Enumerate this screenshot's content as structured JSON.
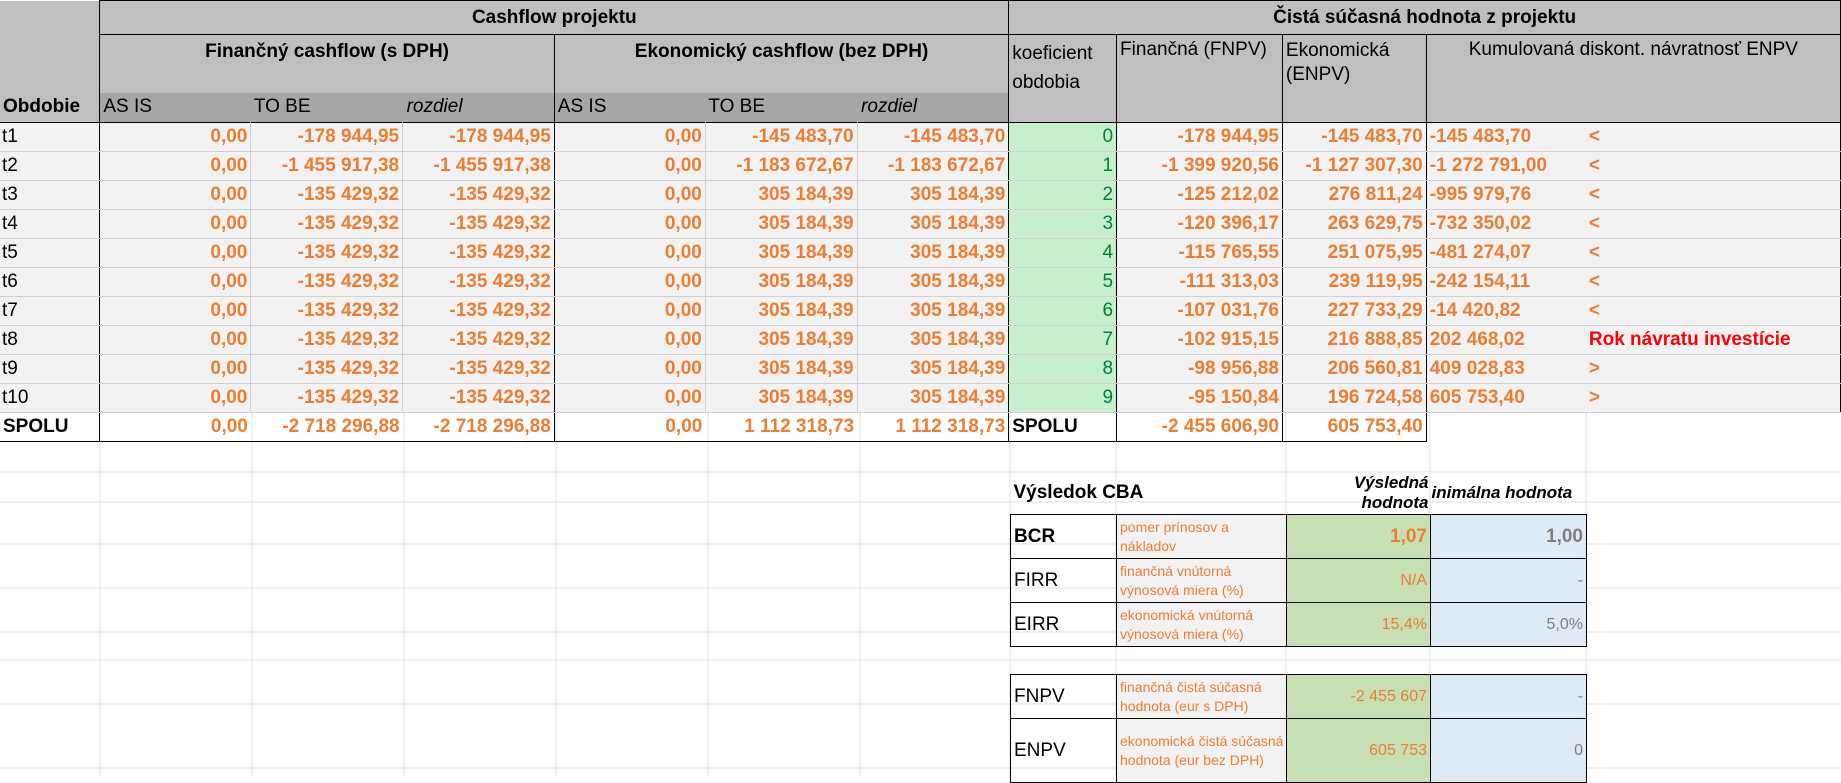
{
  "headers": {
    "cashflow_title": "Cashflow projektu",
    "npv_title": "Čistá súčasná hodnota z projektu",
    "financny_cf": "Finančný cashflow (s DPH)",
    "ekonomicky_cf": "Ekonomický cashflow (bez DPH)",
    "obdobie": "Obdobie",
    "as_is": "AS IS",
    "to_be": "TO BE",
    "rozdiel": "rozdiel",
    "koeficient": "koeficient obdobia",
    "fnpv": "Finančná (FNPV)",
    "enpv": "Ekonomická (ENPV)",
    "kumulovana": "Kumulovaná diskont. návratnosť ENPV"
  },
  "rows": [
    {
      "period": "t1",
      "f_asis": "0,00",
      "f_tobe": "-178 944,95",
      "f_diff": "-178 944,95",
      "e_asis": "0,00",
      "e_tobe": "-145 483,70",
      "e_diff": "-145 483,70",
      "koef": "0",
      "fnpv": "-178 944,95",
      "enpv": "-145 483,70",
      "kum": "-145 483,70",
      "mark": "<"
    },
    {
      "period": "t2",
      "f_asis": "0,00",
      "f_tobe": "-1 455 917,38",
      "f_diff": "-1 455 917,38",
      "e_asis": "0,00",
      "e_tobe": "-1 183 672,67",
      "e_diff": "-1 183 672,67",
      "koef": "1",
      "fnpv": "-1 399 920,56",
      "enpv": "-1 127 307,30",
      "kum": "-1 272 791,00",
      "mark": "<"
    },
    {
      "period": "t3",
      "f_asis": "0,00",
      "f_tobe": "-135 429,32",
      "f_diff": "-135 429,32",
      "e_asis": "0,00",
      "e_tobe": "305 184,39",
      "e_diff": "305 184,39",
      "koef": "2",
      "fnpv": "-125 212,02",
      "enpv": "276 811,24",
      "kum": "-995 979,76",
      "mark": "<"
    },
    {
      "period": "t4",
      "f_asis": "0,00",
      "f_tobe": "-135 429,32",
      "f_diff": "-135 429,32",
      "e_asis": "0,00",
      "e_tobe": "305 184,39",
      "e_diff": "305 184,39",
      "koef": "3",
      "fnpv": "-120 396,17",
      "enpv": "263 629,75",
      "kum": "-732 350,02",
      "mark": "<"
    },
    {
      "period": "t5",
      "f_asis": "0,00",
      "f_tobe": "-135 429,32",
      "f_diff": "-135 429,32",
      "e_asis": "0,00",
      "e_tobe": "305 184,39",
      "e_diff": "305 184,39",
      "koef": "4",
      "fnpv": "-115 765,55",
      "enpv": "251 075,95",
      "kum": "-481 274,07",
      "mark": "<"
    },
    {
      "period": "t6",
      "f_asis": "0,00",
      "f_tobe": "-135 429,32",
      "f_diff": "-135 429,32",
      "e_asis": "0,00",
      "e_tobe": "305 184,39",
      "e_diff": "305 184,39",
      "koef": "5",
      "fnpv": "-111 313,03",
      "enpv": "239 119,95",
      "kum": "-242 154,11",
      "mark": "<"
    },
    {
      "period": "t7",
      "f_asis": "0,00",
      "f_tobe": "-135 429,32",
      "f_diff": "-135 429,32",
      "e_asis": "0,00",
      "e_tobe": "305 184,39",
      "e_diff": "305 184,39",
      "koef": "6",
      "fnpv": "-107 031,76",
      "enpv": "227 733,29",
      "kum": "-14 420,82",
      "mark": "<"
    },
    {
      "period": "t8",
      "f_asis": "0,00",
      "f_tobe": "-135 429,32",
      "f_diff": "-135 429,32",
      "e_asis": "0,00",
      "e_tobe": "305 184,39",
      "e_diff": "305 184,39",
      "koef": "7",
      "fnpv": "-102 915,15",
      "enpv": "216 888,85",
      "kum": "202 468,02",
      "mark": "Rok návratu investície"
    },
    {
      "period": "t9",
      "f_asis": "0,00",
      "f_tobe": "-135 429,32",
      "f_diff": "-135 429,32",
      "e_asis": "0,00",
      "e_tobe": "305 184,39",
      "e_diff": "305 184,39",
      "koef": "8",
      "fnpv": "-98 956,88",
      "enpv": "206 560,81",
      "kum": "409 028,83",
      "mark": ">"
    },
    {
      "period": "t10",
      "f_asis": "0,00",
      "f_tobe": "-135 429,32",
      "f_diff": "-135 429,32",
      "e_asis": "0,00",
      "e_tobe": "305 184,39",
      "e_diff": "305 184,39",
      "koef": "9",
      "fnpv": "-95 150,84",
      "enpv": "196 724,58",
      "kum": "605 753,40",
      "mark": ">"
    }
  ],
  "totals": {
    "label": "SPOLU",
    "f_asis": "0,00",
    "f_tobe": "-2 718 296,88",
    "f_diff": "-2 718 296,88",
    "e_asis": "0,00",
    "e_tobe": "1 112 318,73",
    "e_diff": "1 112 318,73",
    "label2": "SPOLU",
    "fnpv": "-2 455 606,90",
    "enpv": "605 753,40"
  },
  "cba": {
    "title": "Výsledok CBA",
    "col_result": "Výsledná hodnota",
    "col_min": "inimálna hodnota",
    "items": [
      {
        "abbr": "BCR",
        "desc": "pomer prínosov a nákladov",
        "result": "1,07",
        "min": "1,00"
      },
      {
        "abbr": "FIRR",
        "desc": "finančná vnútorná výnosová miera (%)",
        "result": "N/A",
        "min": "-"
      },
      {
        "abbr": "EIRR",
        "desc": "ekonomická vnútorná výnosová miera (%)",
        "result": "15,4%",
        "min": "5,0%"
      },
      {
        "abbr": "FNPV",
        "desc": "finančná čistá súčasná hodnota (eur s DPH)",
        "result": "-2 455 607",
        "min": "-"
      },
      {
        "abbr": "ENPV",
        "desc": "ekonomická čistá súčasná hodnota (eur bez DPH)",
        "result": "605 753",
        "min": "0"
      }
    ]
  },
  "colors": {
    "header_gray": "#bfbfbf",
    "subheader_gray": "#a6a6a6",
    "value_orange": "#ed7d31",
    "koef_green_bg": "#c6efce",
    "koef_green_text": "#00803c",
    "payback_red": "#ff0000",
    "result_green_bg": "#c6e0b4",
    "min_blue_bg": "#ddebf7"
  }
}
